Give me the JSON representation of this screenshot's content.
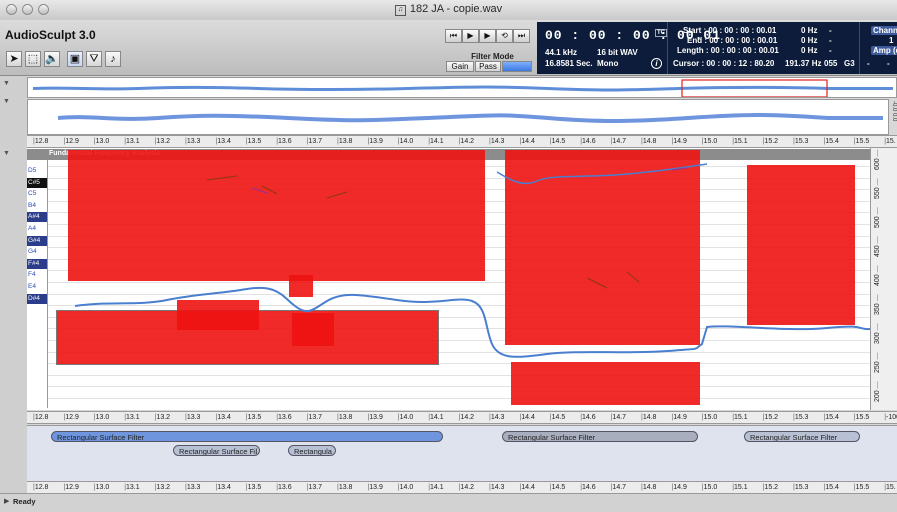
{
  "window": {
    "title": "182 JA - copie.wav",
    "title_icon": "document-icon"
  },
  "app": {
    "name": "AudioSculpt 3.0"
  },
  "toolbar": {
    "tools": [
      {
        "name": "arrow-tool-icon",
        "glyph": "➤"
      },
      {
        "name": "rectangle-select-tool-icon",
        "glyph": "⬚"
      },
      {
        "name": "speaker-tool-icon",
        "glyph": "🔈"
      },
      {
        "name": "rectangle-filter-tool-icon",
        "glyph": "▣"
      },
      {
        "name": "funnel-tool-icon",
        "glyph": "⛛"
      },
      {
        "name": "note-tool-icon",
        "glyph": "♪"
      }
    ],
    "transport": [
      {
        "name": "rewind-button",
        "glyph": "⏮"
      },
      {
        "name": "play-button",
        "glyph": "▶"
      },
      {
        "name": "play-selection-button",
        "glyph": "▶"
      },
      {
        "name": "loop-button",
        "glyph": "⟲"
      },
      {
        "name": "forward-end-button",
        "glyph": "⏭"
      }
    ],
    "filter_mode": {
      "label": "Filter Mode",
      "gain": "Gain",
      "pass": "Pass",
      "third": ""
    }
  },
  "display": {
    "timecode": "00 : 00 : 00 : 00.01",
    "sample_rate": "44.1 kHz",
    "bit_depth": "16 bit WAV",
    "duration": "16.8581 Sec.",
    "channels_mode": "Mono",
    "start": "Start : 00 : 00 : 00 : 00.01",
    "end": "End : 00 : 00 : 00 : 00.01",
    "length": "Length : 00 : 00 : 00 : 00.01",
    "cursor": "Cursor : 00 : 00 : 12 : 80.20",
    "start_hz": "0 Hz",
    "end_hz": "0 Hz",
    "length_hz": "0 Hz",
    "cursor_hz": "191.37 Hz",
    "cursor_midi": "055",
    "cursor_note": "G3",
    "dash1": "-",
    "dash2": "-",
    "dash3": "-",
    "dash4": "-",
    "channel_label": "Channel",
    "channel_value": "1",
    "amp_label": "Amp (dB",
    "amp_value": "-"
  },
  "ruler_ticks": [
    "12.8",
    "12.9",
    "13.0",
    "13.1",
    "13.2",
    "13.3",
    "13.4",
    "13.5",
    "13.6",
    "13.7",
    "13.8",
    "13.9",
    "14.0",
    "14.1",
    "14.2",
    "14.3",
    "14.4",
    "14.5",
    "14.6",
    "14.7",
    "14.8",
    "14.9",
    "15.0",
    "15.1",
    "15.2",
    "15.3",
    "15.4",
    "15.5",
    "15."
  ],
  "ruler_ticks_mid": [
    "12.8",
    "12.9",
    "13.0",
    "13.1",
    "13.2",
    "13.3",
    "13.4",
    "13.5",
    "13.6",
    "13.7",
    "13.8",
    "13.9",
    "14.0",
    "14.1",
    "14.2",
    "14.3",
    "14.4",
    "14.5",
    "14.6",
    "14.7",
    "14.8",
    "14.9",
    "15.0",
    "15.1",
    "15.2",
    "15.3",
    "15.4",
    "15.5",
    "-100"
  ],
  "ruler_ticks_bottom": [
    "12.8",
    "12.9",
    "13.0",
    "13.1",
    "13.2",
    "13.3",
    "13.4",
    "13.5",
    "13.6",
    "13.7",
    "13.8",
    "13.9",
    "14.0",
    "14.1",
    "14.2",
    "14.3",
    "14.4",
    "14.5",
    "14.6",
    "14.7",
    "14.8",
    "14.9",
    "15.0",
    "15.1",
    "15.2",
    "15.3",
    "15.4",
    "15.5",
    "15."
  ],
  "wave_scale": "-0.0 0.0",
  "analysis": {
    "label": "Fundamental Frequency Analysis"
  },
  "piano_keys": [
    {
      "label": "D5",
      "type": "white"
    },
    {
      "label": "C#5",
      "type": "black"
    },
    {
      "label": "C5",
      "type": "white"
    },
    {
      "label": "B4",
      "type": "white"
    },
    {
      "label": "A#4",
      "type": "bk"
    },
    {
      "label": "A4",
      "type": "white"
    },
    {
      "label": "G#4",
      "type": "bk"
    },
    {
      "label": "G4",
      "type": "white"
    },
    {
      "label": "F#4",
      "type": "bk"
    },
    {
      "label": "F4",
      "type": "white"
    },
    {
      "label": "E4",
      "type": "white"
    },
    {
      "label": "D#4",
      "type": "bk"
    },
    {
      "label": "",
      "type": "white"
    },
    {
      "label": "",
      "type": "black"
    },
    {
      "label": "",
      "type": "white"
    },
    {
      "label": "",
      "type": "black"
    },
    {
      "label": "",
      "type": "white"
    },
    {
      "label": "",
      "type": "black"
    },
    {
      "label": "",
      "type": "white"
    },
    {
      "label": "",
      "type": "black"
    },
    {
      "label": "",
      "type": "white"
    }
  ],
  "freq_ticks": [
    "600",
    "550",
    "500",
    "450",
    "400",
    "350",
    "300",
    "250",
    "200"
  ],
  "filters": [
    {
      "label": "Rectangular Surface Filter",
      "style": "blue"
    },
    {
      "label": "Rectangular Surface Filter",
      "style": "grey"
    },
    {
      "label": "Rectangular Surface Filter",
      "style": "light"
    },
    {
      "label": "Rectangular Surface Fil",
      "style": "light"
    },
    {
      "label": "Rectangula",
      "style": "light"
    }
  ],
  "status": {
    "text": "Ready"
  },
  "colors": {
    "filter_red": "#ee1212",
    "lcd_bg": "#0c1c3a",
    "pitch_curve": "#4a7fd0"
  }
}
